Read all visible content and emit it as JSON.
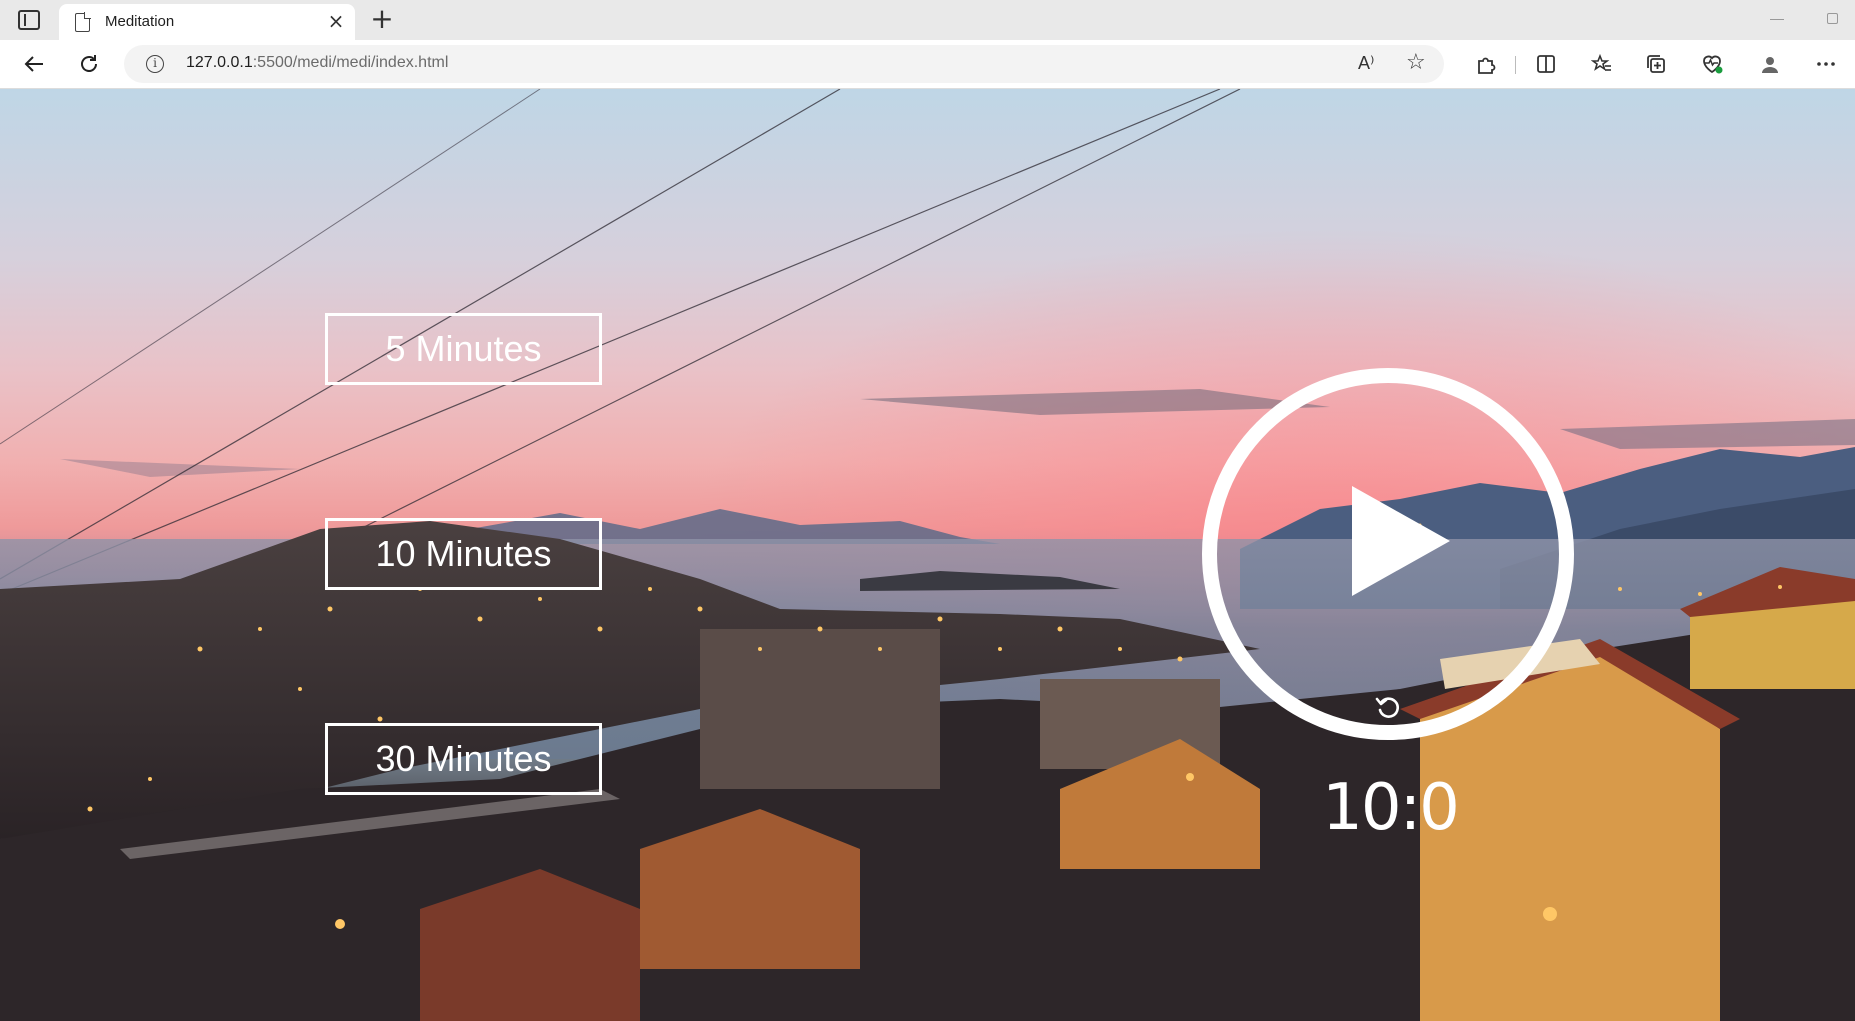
{
  "browser": {
    "tab_title": "Meditation",
    "url_host": "127.0.0.1",
    "url_rest": ":5500/medi/medi/index.html",
    "read_aloud_label": "A⁾"
  },
  "icons": {
    "sidebar_toggle": "sidebar-toggle-icon",
    "page": "page-icon",
    "close": "close-icon",
    "new_tab": "plus-icon",
    "back": "back-arrow-icon",
    "refresh": "refresh-icon",
    "info": "info-icon",
    "favorite": "star-icon",
    "extensions": "puzzle-icon",
    "split_screen": "split-screen-icon",
    "favorites": "favorites-icon",
    "collections": "collections-icon",
    "browser_essentials": "heart-pulse-icon",
    "profile": "profile-icon",
    "more": "more-icon",
    "play": "play-icon",
    "replay": "replay-icon"
  },
  "timer_buttons": [
    {
      "label": "5 Minutes"
    },
    {
      "label": "10 Minutes"
    },
    {
      "label": "30 Minutes"
    }
  ],
  "player": {
    "time_display": "10:0"
  },
  "colors": {
    "overlay_text": "#ffffff",
    "sky_top": "#bfd6e6",
    "sunset_pink": "#ef9a9a"
  }
}
